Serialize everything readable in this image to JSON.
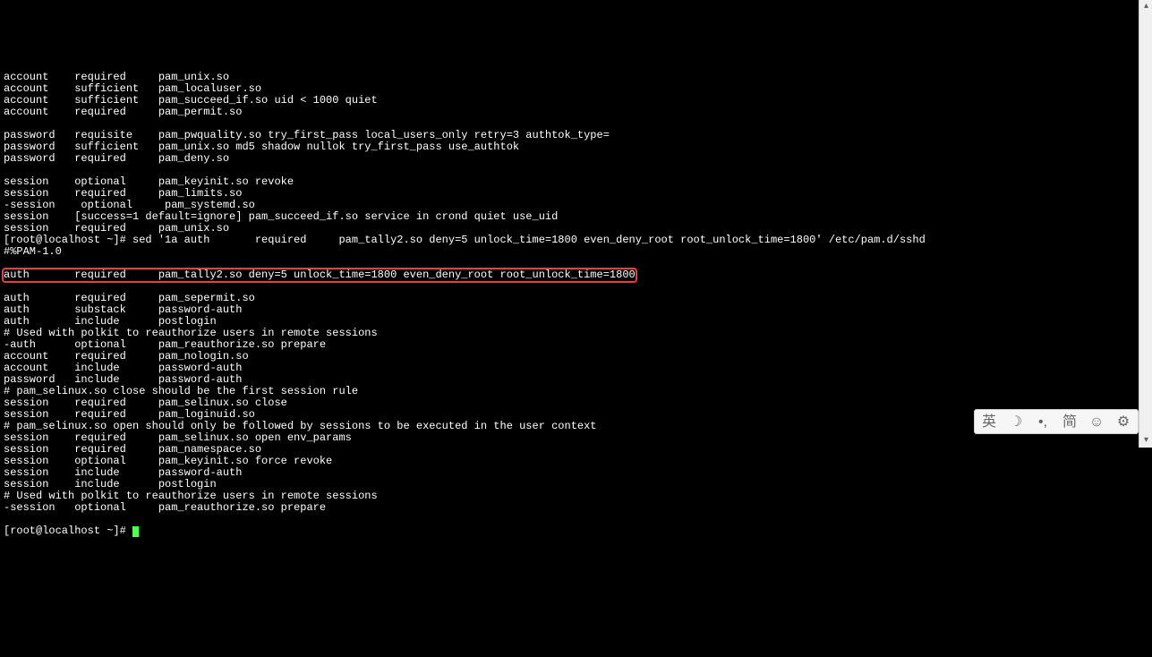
{
  "terminal": {
    "lines_before": [
      "account    required     pam_unix.so",
      "account    sufficient   pam_localuser.so",
      "account    sufficient   pam_succeed_if.so uid < 1000 quiet",
      "account    required     pam_permit.so",
      "",
      "password   requisite    pam_pwquality.so try_first_pass local_users_only retry=3 authtok_type=",
      "password   sufficient   pam_unix.so md5 shadow nullok try_first_pass use_authtok",
      "password   required     pam_deny.so",
      "",
      "session    optional     pam_keyinit.so revoke",
      "session    required     pam_limits.so",
      "-session    optional     pam_systemd.so",
      "session    [success=1 default=ignore] pam_succeed_if.so service in crond quiet use_uid",
      "session    required     pam_unix.so",
      "[root@localhost ~]# sed '1a auth       required     pam_tally2.so deny=5 unlock_time=1800 even_deny_root root_unlock_time=1800' /etc/pam.d/sshd",
      "#%PAM-1.0"
    ],
    "highlighted_line": "auth       required     pam_tally2.so deny=5 unlock_time=1800 even_deny_root root_unlock_time=1800",
    "lines_after": [
      "auth       required     pam_sepermit.so",
      "auth       substack     password-auth",
      "auth       include      postlogin",
      "# Used with polkit to reauthorize users in remote sessions",
      "-auth      optional     pam_reauthorize.so prepare",
      "account    required     pam_nologin.so",
      "account    include      password-auth",
      "password   include      password-auth",
      "# pam_selinux.so close should be the first session rule",
      "session    required     pam_selinux.so close",
      "session    required     pam_loginuid.so",
      "# pam_selinux.so open should only be followed by sessions to be executed in the user context",
      "session    required     pam_selinux.so open env_params",
      "session    required     pam_namespace.so",
      "session    optional     pam_keyinit.so force revoke",
      "session    include      password-auth",
      "session    include      postlogin",
      "# Used with polkit to reauthorize users in remote sessions",
      "-session   optional     pam_reauthorize.so prepare"
    ],
    "prompt": "[root@localhost ~]# "
  },
  "ime": {
    "items": [
      "英",
      "简"
    ],
    "moon_icon": "☽",
    "punct_icon": "•,",
    "smile_icon": "☺",
    "gear_icon": "⚙"
  },
  "scrollbar": {
    "up": "▴",
    "down": "▾"
  }
}
